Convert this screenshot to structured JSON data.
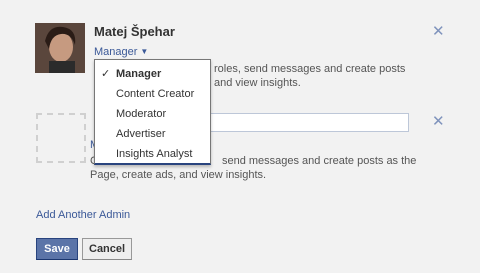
{
  "admin": {
    "name": "Matej Špehar",
    "role_label": "Manager",
    "description_visible": "roles, send messages and create posts\nand view insights."
  },
  "role_menu": {
    "items": [
      {
        "label": "Manager",
        "selected": true
      },
      {
        "label": "Content Creator",
        "selected": false
      },
      {
        "label": "Moderator",
        "selected": false
      },
      {
        "label": "Advertiser",
        "selected": false
      },
      {
        "label": "Insights Analyst",
        "selected": false
      }
    ]
  },
  "new_admin": {
    "name_input_value": "",
    "description_line1_visible": "send messages and create posts as the",
    "description_line2": "Page, create ads, and view insights.",
    "clipped_role_letter": "M",
    "clipped_desc_letter": "C"
  },
  "add_admin_label": "Add Another Admin",
  "buttons": {
    "save": "Save",
    "cancel": "Cancel"
  },
  "icons": {
    "close": "close-icon",
    "check": "check-icon",
    "dropdown_arrow": "dropdown-arrow-icon"
  },
  "colors": {
    "link": "#3b5998",
    "primary_button": "#5b74a8",
    "background": "#f2f2f2"
  }
}
